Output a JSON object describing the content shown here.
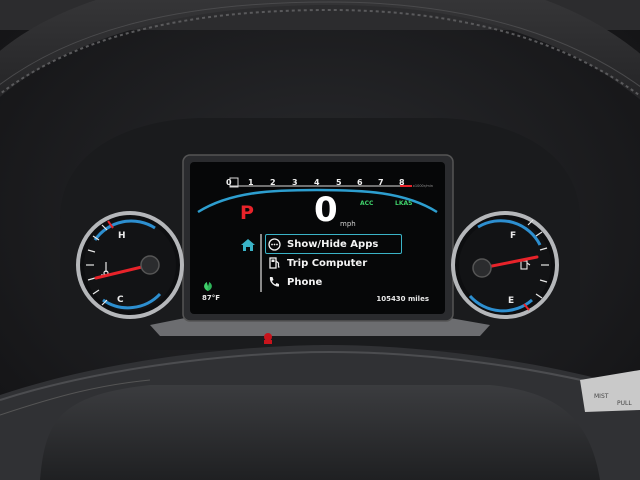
{
  "tachometer": {
    "ticks": [
      "0",
      "1",
      "2",
      "3",
      "4",
      "5",
      "6",
      "7",
      "8"
    ],
    "unit": "x1000r/min"
  },
  "gear": "P",
  "speed": {
    "value": "0",
    "unit": "mph"
  },
  "indicators": {
    "acc": "ACC",
    "lkas": "LKAS"
  },
  "menu": {
    "items": [
      {
        "label": "Show/Hide Apps",
        "icon": "apps-icon",
        "selected": true
      },
      {
        "label": "Trip Computer",
        "icon": "fuel-pump-icon",
        "selected": false
      },
      {
        "label": "Phone",
        "icon": "phone-icon",
        "selected": false
      }
    ]
  },
  "status": {
    "temperature": "87°F",
    "odometer": "105430 miles"
  },
  "coolant_gauge": {
    "high_label": "H",
    "low_label": "C",
    "level": 0.5
  },
  "fuel_gauge": {
    "full_label": "F",
    "empty_label": "E",
    "level": 0.55
  },
  "colors": {
    "accent": "#3ab3c7",
    "gear": "#e8232a",
    "indicator": "#3fd06a",
    "needle": "#e8232a"
  }
}
